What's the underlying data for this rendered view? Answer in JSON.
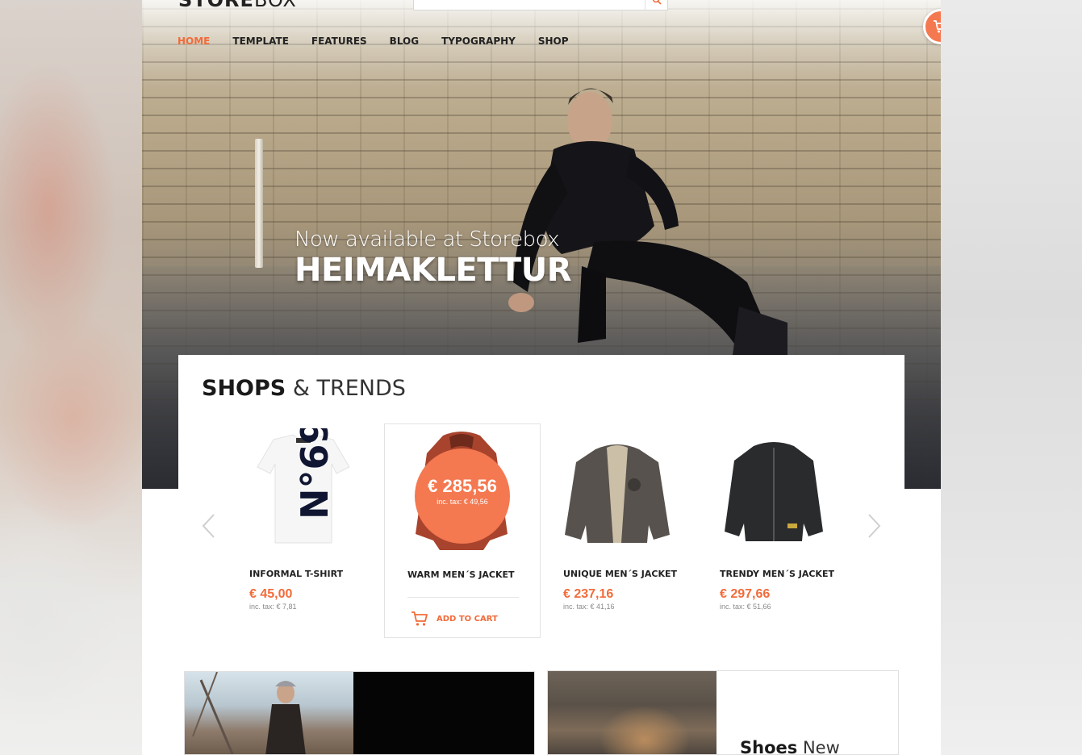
{
  "header": {
    "logo_bold": "STORE",
    "logo_thin": "BOX"
  },
  "nav": {
    "items": [
      {
        "label": "HOME",
        "active": true
      },
      {
        "label": "TEMPLATE",
        "active": false
      },
      {
        "label": "FEATURES",
        "active": false
      },
      {
        "label": "BLOG",
        "active": false
      },
      {
        "label": "TYPOGRAPHY",
        "active": false
      },
      {
        "label": "SHOP",
        "active": false
      }
    ]
  },
  "hero": {
    "subtitle": "Now available at Storebox",
    "title": "HEIMAKLETTUR"
  },
  "shops": {
    "title_bold": "SHOPS",
    "title_thin": "& TRENDS",
    "products": [
      {
        "name": "INFORMAL T-SHIRT",
        "price": "€ 45,00",
        "tax": "inc. tax: € 7,81",
        "image": "tshirt-n69"
      },
      {
        "name": "WARM MEN´S JACKET",
        "price": "€ 285,56",
        "tax": "inc. tax: € 49,56",
        "image": "red-jacket",
        "highlight": true,
        "add_to_cart": "ADD TO CART"
      },
      {
        "name": "UNIQUE MEN´S JACKET",
        "price": "€ 237,16",
        "tax": "inc. tax: € 41,16",
        "image": "grey-jacket"
      },
      {
        "name": "TRENDY MEN´S JACKET",
        "price": "€ 297,66",
        "tax": "inc. tax: € 51,66",
        "image": "black-jacket"
      }
    ]
  },
  "tiles": {
    "right_caption_bold": "Shoes",
    "right_caption_thin": "New"
  },
  "colors": {
    "accent": "#f26b3a",
    "accent_bubble": "#f47850",
    "text_dark": "#222222"
  },
  "icons": {
    "cart": "cart-icon",
    "search": "search-icon",
    "prev": "chevron-left-icon",
    "next": "chevron-right-icon"
  }
}
